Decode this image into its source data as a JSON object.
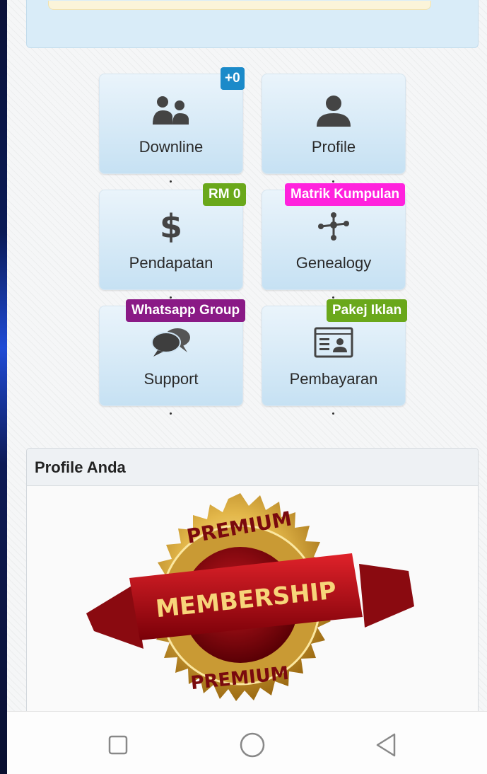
{
  "tiles": [
    {
      "label": "Downline",
      "icon": "users-icon"
    },
    {
      "label": "Profile",
      "icon": "user-icon"
    },
    {
      "label": "Pendapatan",
      "icon": "dollar-icon"
    },
    {
      "label": "Genealogy",
      "icon": "network-icon"
    },
    {
      "label": "Support",
      "icon": "chat-bubbles-icon"
    },
    {
      "label": "Pembayaran",
      "icon": "id-card-icon"
    }
  ],
  "badges": {
    "downline": {
      "text": "+0",
      "color": "#1b8ac9"
    },
    "pendapatan": {
      "text": "RM 0",
      "color": "#6aa81b"
    },
    "genealogy": {
      "text": "Matrik Kumpulan",
      "color": "#ff22dd"
    },
    "support": {
      "text": "Whatsapp Group",
      "color": "#8a1a86"
    },
    "pembayaran": {
      "text": "Pakej Iklan",
      "color": "#6aa81b"
    }
  },
  "profile_panel": {
    "title": "Profile Anda",
    "image_alt": "premium-membership-badge",
    "seal_top": "PREMIUM",
    "seal_ribbon": "MEMBERSHIP",
    "seal_bottom": "PREMIUM"
  },
  "nav": [
    "recent-apps-icon",
    "home-icon",
    "back-icon"
  ]
}
